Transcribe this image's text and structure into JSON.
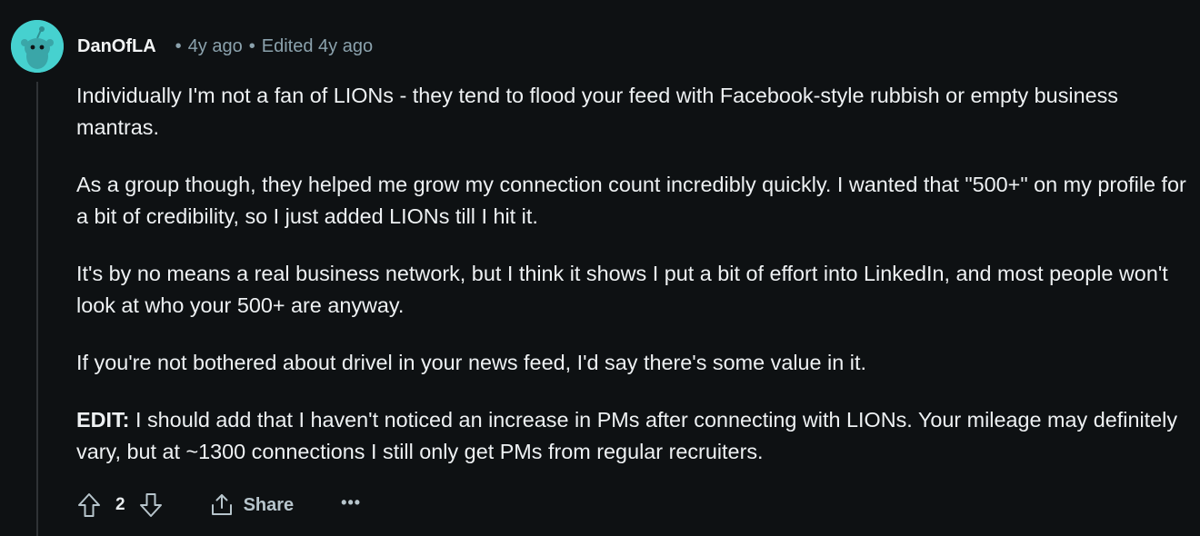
{
  "comment": {
    "author": "DanOfLA",
    "age": "4y ago",
    "edited": "Edited 4y ago",
    "separator": "•",
    "paragraphs": [
      "Individually I'm not a fan of LIONs - they tend to flood your feed with Facebook-style rubbish or empty business mantras.",
      "As a group though, they helped me grow my connection count incredibly quickly. I wanted that \"500+\" on my profile for a bit of credibility, so I just added LIONs till I hit it.",
      "It's by no means a real business network, but I think it shows I put a bit of effort into LinkedIn, and most people won't look at who your 500+ are anyway.",
      "If you're not bothered about drivel in your news feed, I'd say there's some value in it."
    ],
    "edit_label": "EDIT:",
    "edit_text": " I should add that I haven't noticed an increase in PMs after connecting with LIONs. Your mileage may definitely vary, but at ~1300 connections I still only get PMs from regular recruiters."
  },
  "actions": {
    "score": "2",
    "share_label": "Share",
    "more_label": "•••",
    "icons": {
      "upvote": "upvote-arrow-icon",
      "downvote": "downvote-arrow-icon",
      "share": "share-icon",
      "avatar": "snoo-avatar-icon"
    }
  },
  "colors": {
    "background": "#0e1113",
    "avatar": "#46d1cf",
    "meta": "#8ba2ad",
    "text": "#eef1f3"
  }
}
